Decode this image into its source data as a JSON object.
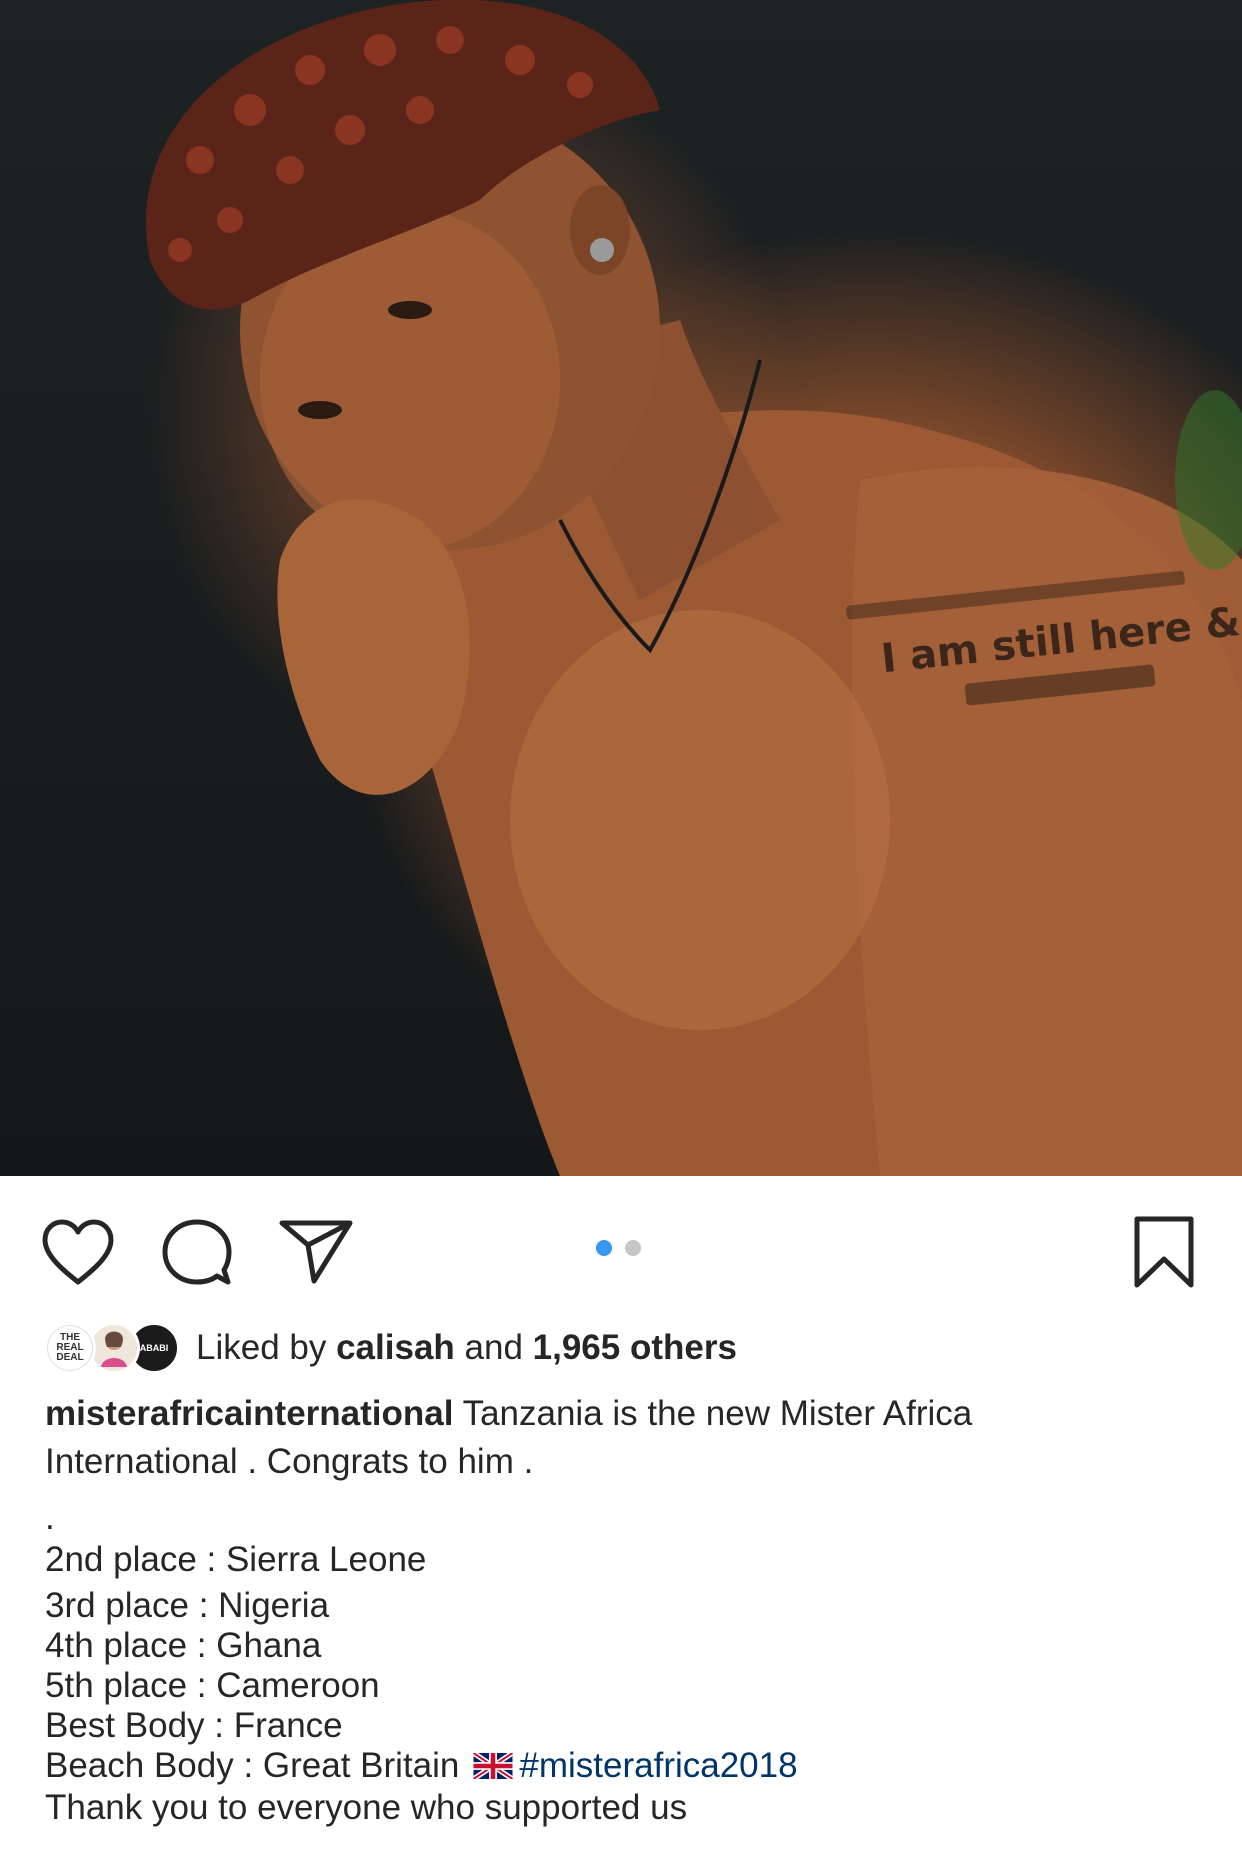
{
  "post": {
    "image_alt": "Shirtless man with curly red hair posing against dark background",
    "tattoo_text": "I am still here & safe.",
    "carousel": {
      "count": 2,
      "active_index": 0
    }
  },
  "actions": {
    "like_icon": "heart-icon",
    "comment_icon": "comment-icon",
    "share_icon": "send-icon",
    "save_icon": "bookmark-icon"
  },
  "likes": {
    "prefix": "Liked by ",
    "user": "calisah",
    "middle": " and ",
    "others": "1,965 others",
    "avatar1_text": "THE REAL DEAL",
    "avatar3_text": "ABABI"
  },
  "caption": {
    "username": "misterafricainternational",
    "lines": [
      "Tanzania is the new Mister Africa",
      "International . Congrats to him .",
      ".",
      "2nd place :  Sierra Leone",
      "3rd place : Nigeria",
      "4th place : Ghana",
      "5th place : Cameroon",
      "Best Body : France",
      "Beach Body : Great Britain",
      "Thank you to everyone who supported us"
    ],
    "hashtag": "#misterafrica2018",
    "flag": "uk-flag-icon"
  },
  "colors": {
    "accent_blue": "#3897f0",
    "hashtag": "#003569",
    "text": "#262626"
  }
}
